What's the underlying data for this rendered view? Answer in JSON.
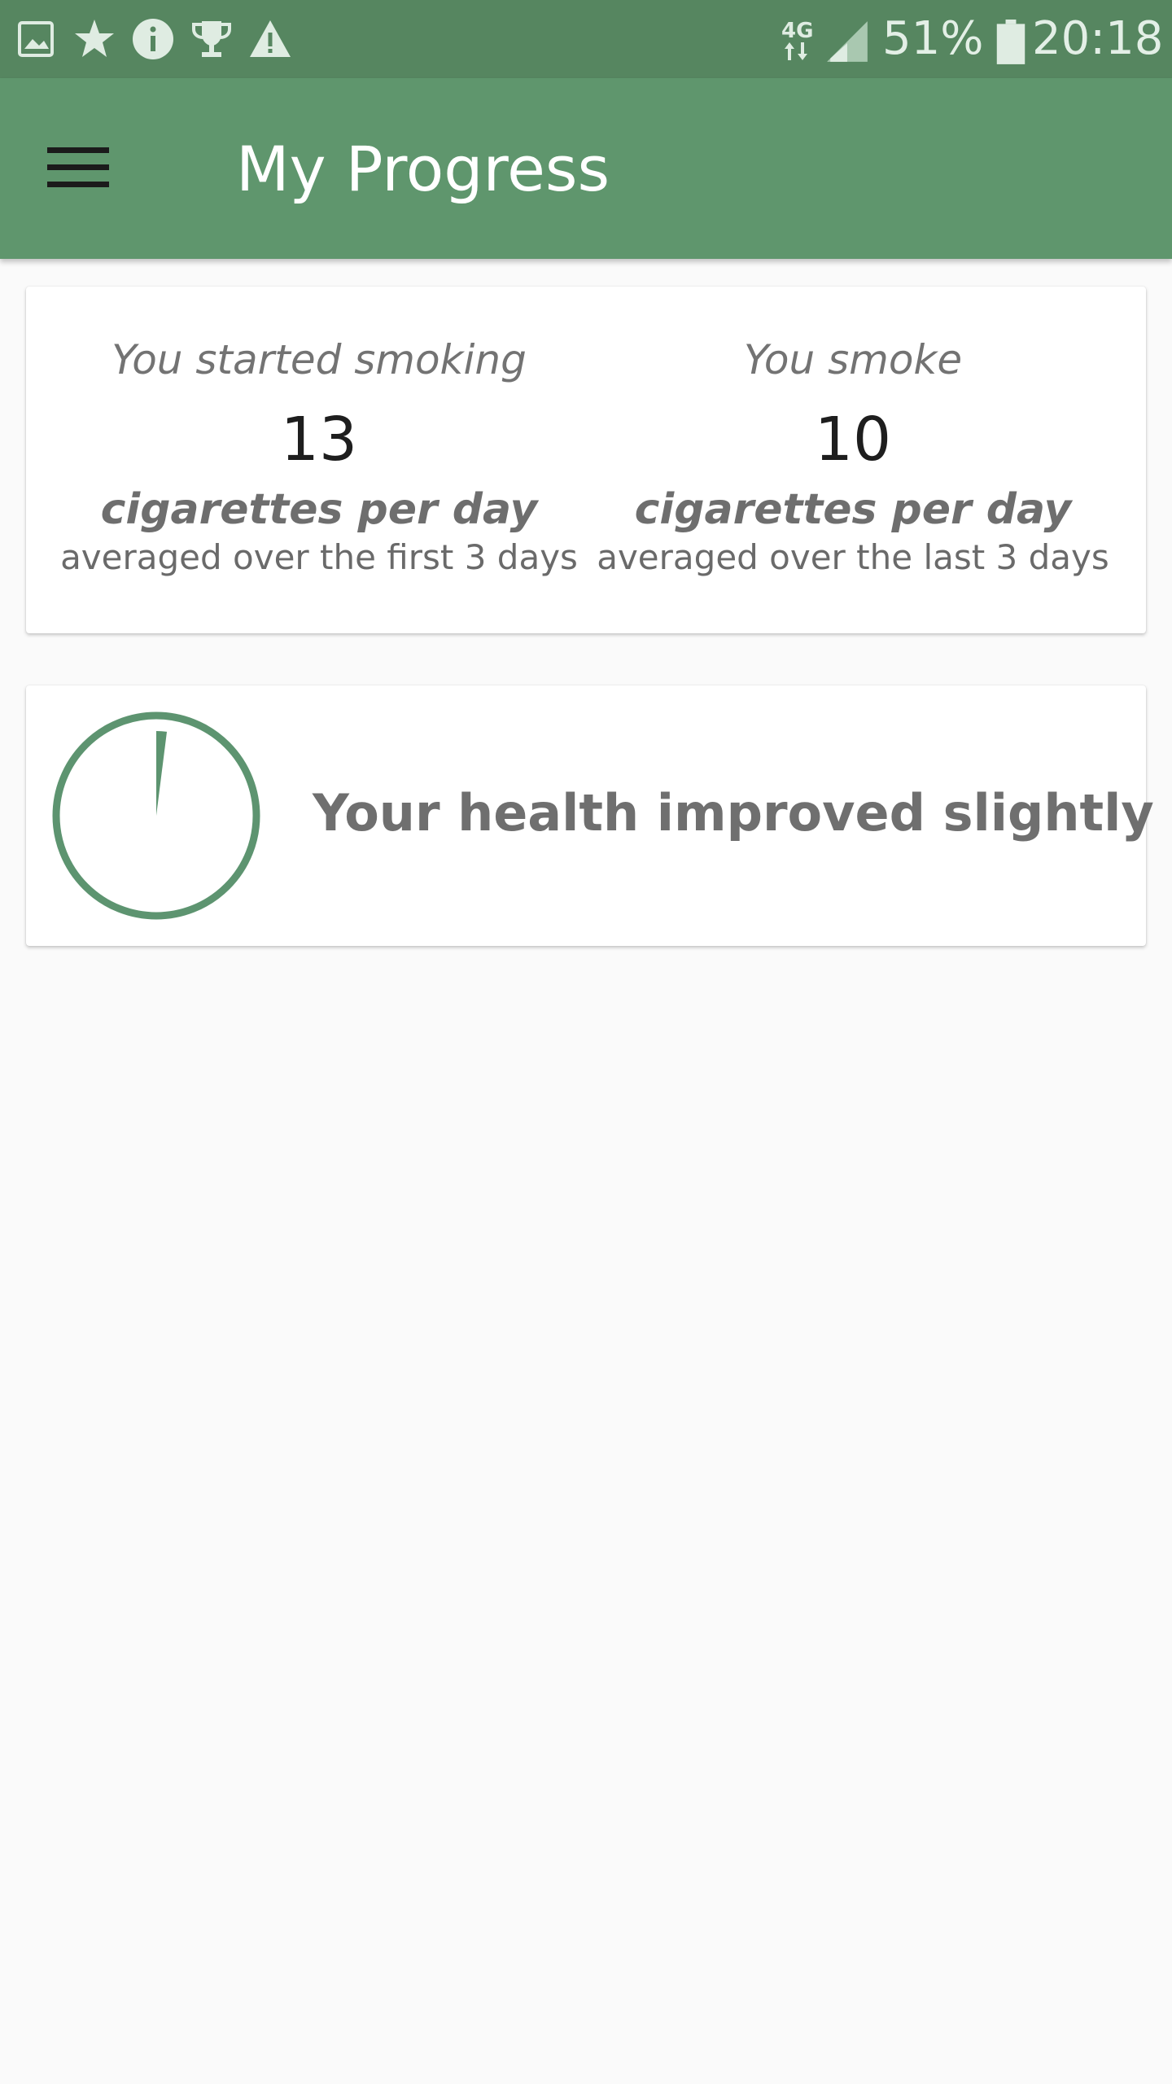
{
  "status_bar": {
    "icons": [
      "image-icon",
      "star-icon",
      "info-icon",
      "trophy-icon",
      "warning-icon",
      "network-4g-icon",
      "signal-icon",
      "battery-icon"
    ],
    "network_label": "4G",
    "battery": "51%",
    "time": "20:18"
  },
  "app_bar": {
    "menu_icon": "hamburger-menu-icon",
    "title": "My Progress"
  },
  "stats": {
    "started": {
      "lead": "You started smoking",
      "value": "13",
      "unit": "cigarettes per day",
      "note": "averaged over the first 3 days"
    },
    "current": {
      "lead": "You smoke",
      "value": "10",
      "unit": "cigarettes per day",
      "note": "averaged over the last 3 days"
    }
  },
  "health": {
    "message": "Your health improved slightly",
    "gauge_icon": "health-gauge-icon",
    "gauge_level": 0.02
  },
  "colors": {
    "status_bar": "#568660",
    "app_bar": "#5f966d",
    "accent": "#5d9470",
    "background": "#fafafa"
  }
}
